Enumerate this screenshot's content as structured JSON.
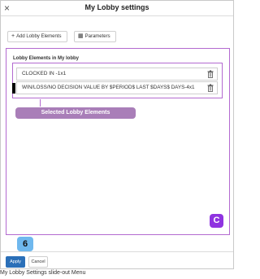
{
  "header": {
    "close_icon": "×",
    "title": "My Lobby settings"
  },
  "toolbar": {
    "add_icon": "+",
    "add_label": "Add Lobby Elements",
    "params_icon": "▦",
    "params_label": "Parameters"
  },
  "lobby": {
    "label": "Lobby Elements in My lobby",
    "items": [
      {
        "label": "CLOCKED IN -1x1"
      },
      {
        "label": "WIN/LOSS/NO DECISION VALUE BY $PERIOD$ LAST $DAYS$ DAYS-4x1"
      }
    ]
  },
  "annotations": {
    "selected_label": "Selected Lobby Elements",
    "badge_c": "C",
    "step_number": "6",
    "accent_color": "#b36ad0"
  },
  "footer": {
    "apply_label": "Apply",
    "cancel_label": "Cancel"
  },
  "caption": "My Lobby Settings slide-out Menu"
}
